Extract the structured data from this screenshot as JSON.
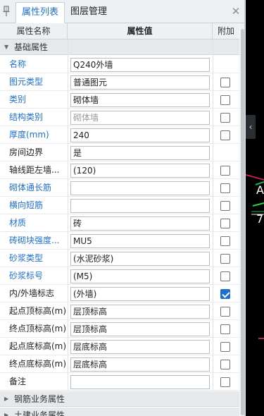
{
  "tabs": [
    "属性列表",
    "图层管理"
  ],
  "active_tab": 0,
  "close_glyph": "✕",
  "grid_header": {
    "name": "属性名称",
    "value": "属性值",
    "extra": "附加"
  },
  "groups": [
    {
      "label": "基础属性",
      "expanded": true
    },
    {
      "label": "钢筋业务属性",
      "expanded": false
    },
    {
      "label": "土建业务属性",
      "expanded": false
    }
  ],
  "rows": [
    {
      "name": "名称",
      "value": "Q240外墙",
      "blue": true,
      "checkbox": null
    },
    {
      "name": "图元类型",
      "value": "普通图元",
      "blue": true,
      "checkbox": false
    },
    {
      "name": "类别",
      "value": "砌体墙",
      "blue": true,
      "checkbox": false
    },
    {
      "name": "结构类别",
      "value": "砌体墙",
      "blue": true,
      "checkbox": false,
      "disabled": true
    },
    {
      "name": "厚度(mm)",
      "value": "240",
      "blue": true,
      "checkbox": false
    },
    {
      "name": "房间边界",
      "value": "是",
      "blue": false,
      "checkbox": null
    },
    {
      "name": "轴线距左墙...",
      "value": "(120)",
      "blue": false,
      "checkbox": false
    },
    {
      "name": "砌体通长筋",
      "value": "",
      "blue": true,
      "checkbox": false
    },
    {
      "name": "横向短筋",
      "value": "",
      "blue": true,
      "checkbox": false
    },
    {
      "name": "材质",
      "value": "砖",
      "blue": true,
      "checkbox": false
    },
    {
      "name": "砖砌块强度...",
      "value": "MU5",
      "blue": true,
      "checkbox": false
    },
    {
      "name": "砂浆类型",
      "value": "(水泥砂浆)",
      "blue": true,
      "checkbox": false
    },
    {
      "name": "砂浆标号",
      "value": "(M5)",
      "blue": true,
      "checkbox": false
    },
    {
      "name": "内/外墙标志",
      "value": "(外墙)",
      "blue": false,
      "checkbox": true
    },
    {
      "name": "起点顶标高(m)",
      "value": "层顶标高",
      "blue": false,
      "checkbox": false
    },
    {
      "name": "终点顶标高(m)",
      "value": "层顶标高",
      "blue": false,
      "checkbox": false
    },
    {
      "name": "起点底标高(m)",
      "value": "层底标高",
      "blue": false,
      "checkbox": false
    },
    {
      "name": "终点底标高(m)",
      "value": "层底标高",
      "blue": false,
      "checkbox": false
    },
    {
      "name": "备注",
      "value": "",
      "blue": false,
      "checkbox": false
    }
  ],
  "canvas_labels": [
    "A",
    "7"
  ],
  "colors": {
    "accent": "#1f6fd0",
    "canvas": "#000000"
  }
}
